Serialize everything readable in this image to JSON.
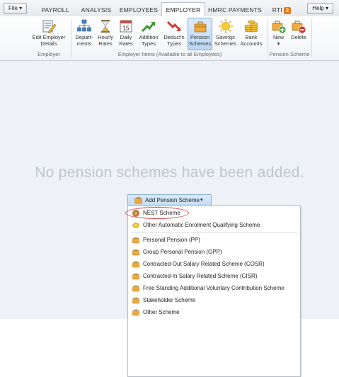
{
  "menubar": {
    "file": "File ▾",
    "help": "Help ▾",
    "tabs": [
      {
        "label": "PAYROLL"
      },
      {
        "label": "ANALYSIS"
      },
      {
        "label": "EMPLOYEES"
      },
      {
        "label": "EMPLOYER",
        "active": true
      },
      {
        "label": "HMRC PAYMENTS"
      },
      {
        "label": "RTI",
        "badge": "2"
      }
    ]
  },
  "ribbon": {
    "groups": [
      {
        "label": "Employer"
      },
      {
        "label": "Employer Items (Available to all Employees)"
      },
      {
        "label": "Pension Scheme"
      }
    ],
    "buttons": [
      {
        "line1": "Edit Employer",
        "line2": "Details",
        "icon": "edit-employer-icon"
      },
      {
        "line1": "Depart-",
        "line2": "ments",
        "icon": "departments-icon"
      },
      {
        "line1": "Hourly",
        "line2": "Rates",
        "icon": "hourglass-icon"
      },
      {
        "line1": "Daily",
        "line2": "Rates",
        "icon": "calendar-icon",
        "day": "15"
      },
      {
        "line1": "Addition",
        "line2": "Types",
        "icon": "green-arrow-up-icon"
      },
      {
        "line1": "Deduct'n",
        "line2": "Types",
        "icon": "red-arrow-down-icon"
      },
      {
        "line1": "Pension",
        "line2": "Schemes",
        "icon": "pension-schemes-icon",
        "selected": true
      },
      {
        "line1": "Savings",
        "line2": "Schemes",
        "icon": "sun-icon"
      },
      {
        "line1": "Bank",
        "line2": "Accounts",
        "icon": "coins-icon"
      },
      {
        "line1": "New",
        "line2": "▾",
        "icon": "new-scheme-icon"
      },
      {
        "line1": "Delete",
        "line2": "",
        "icon": "delete-scheme-icon"
      }
    ]
  },
  "main": {
    "empty_message": "No pension schemes have been added.",
    "add_button": "Add Pension Scheme",
    "add_caret": "▾"
  },
  "menu": {
    "items": [
      {
        "label": "NEST Scheme",
        "icon": "nest-icon"
      },
      {
        "label": "Other Automatic Enrolment Qualifying Scheme",
        "icon": "auto-enrolment-icon"
      },
      {
        "label": "Personal Pension (PP)",
        "icon": "folder-icon"
      },
      {
        "label": "Group Personal Pension (GPP)",
        "icon": "folder-icon"
      },
      {
        "label": "Contracted-Out Salary Related Scheme (COSR)",
        "icon": "folder-icon"
      },
      {
        "label": "Contracted-In Salary Related Scheme (CISR)",
        "icon": "folder-icon"
      },
      {
        "label": "Free Standing Additional Voluntary Contribution Scheme",
        "icon": "folder-icon"
      },
      {
        "label": "Stakeholder Scheme",
        "icon": "folder-icon"
      },
      {
        "label": "Other Scheme",
        "icon": "folder-icon"
      }
    ]
  },
  "colors": {
    "accent_badge": "#e7781c",
    "highlight_ring": "#d9504f",
    "empty_text": "#bfc5cb",
    "selected_button": "#bcd8f5"
  }
}
